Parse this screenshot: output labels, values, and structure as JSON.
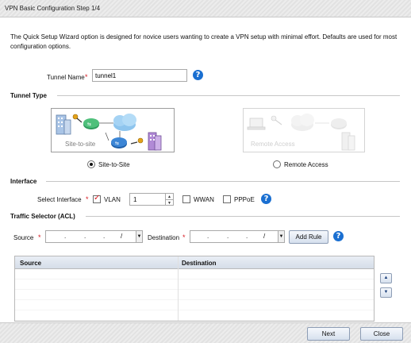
{
  "window": {
    "title": "VPN Basic Configuration  Step 1/4"
  },
  "intro": "The Quick Setup Wizard option is designed for novice users wanting to create a VPN setup with minimal effort. Defaults are used for most configuration options.",
  "required_marker": "*",
  "tunnel_name": {
    "label": "Tunnel Name",
    "value": "tunnel1"
  },
  "tunnel_type": {
    "heading": "Tunnel Type",
    "options": [
      {
        "card_label": "Site-to-site",
        "radio_label": "Site-to-Site",
        "selected": true
      },
      {
        "card_label": "Remote Access",
        "radio_label": "Remote Access",
        "selected": false
      }
    ]
  },
  "interface": {
    "heading": "Interface",
    "select_label": "Select Interface",
    "vlan": {
      "label": "VLAN",
      "checked": true,
      "value": "1"
    },
    "wwan": {
      "label": "WWAN",
      "checked": false
    },
    "pppoe": {
      "label": "PPPoE",
      "checked": false
    }
  },
  "traffic_selector": {
    "heading": "Traffic Selector (ACL)",
    "source_label": "Source",
    "destination_label": "Destination",
    "add_rule_label": "Add Rule",
    "columns": [
      "Source",
      "Destination"
    ],
    "rows": []
  },
  "footer": {
    "next_label": "Next",
    "close_label": "Close"
  },
  "icons": {
    "help": "?",
    "dropdown": "▼",
    "up": "▲",
    "down": "▼"
  },
  "colors": {
    "required": "#d71920",
    "help": "#1a6fd1",
    "accent_icon": "#2e7fd9"
  }
}
